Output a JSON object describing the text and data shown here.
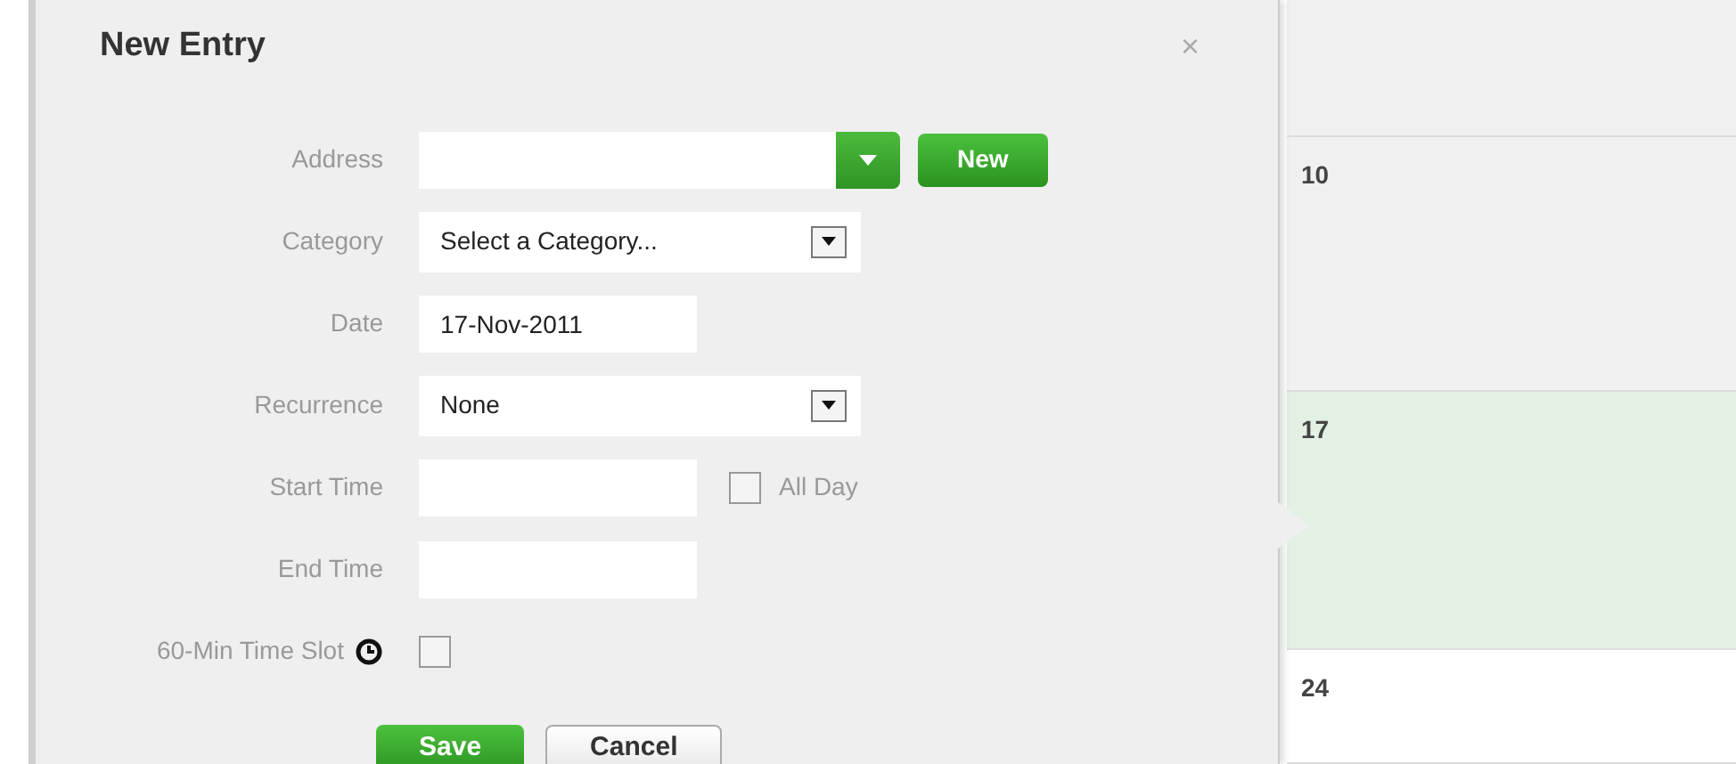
{
  "dialog": {
    "title": "New Entry",
    "close": "×",
    "fields": [
      {
        "kind": "combo",
        "label": "Address",
        "button": "New"
      },
      {
        "kind": "select",
        "label": "Category",
        "value": "Select a Category..."
      },
      {
        "kind": "text",
        "label": "Date",
        "value": "17-Nov-2011"
      },
      {
        "kind": "select",
        "label": "Recurrence",
        "value": "None"
      },
      {
        "kind": "time",
        "label": "Start Time",
        "checkbox": {
          "label": "All Day",
          "checked": false
        }
      },
      {
        "kind": "time",
        "label": "End Time"
      },
      {
        "kind": "check",
        "label": "60-Min Time Slot",
        "checked": false
      }
    ],
    "buttons": [
      {
        "label": "Save",
        "primary": true
      },
      {
        "label": "Cancel",
        "primary": false
      }
    ]
  },
  "calendar": {
    "cells": [
      {
        "highlighted": false
      },
      {
        "day": "10",
        "highlighted": false
      },
      {
        "day": "17",
        "highlighted": true
      },
      {
        "day": "24",
        "highlighted": false
      }
    ]
  }
}
